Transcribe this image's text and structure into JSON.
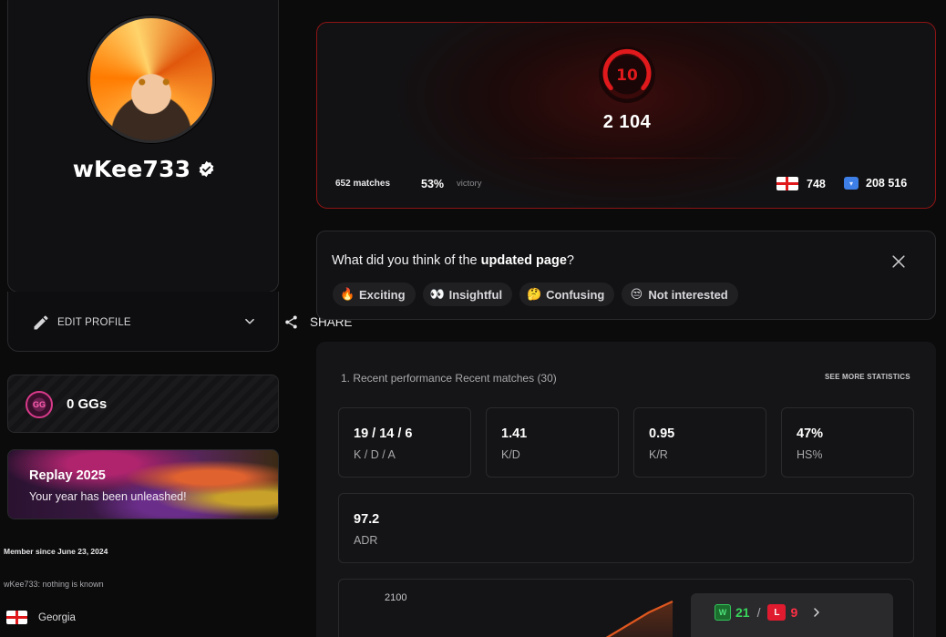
{
  "profile": {
    "username": "wKee733",
    "edit_label": "EDIT PROFILE",
    "share_label": "SHARE"
  },
  "gg": {
    "label": "0 GGs",
    "badge_text": "GG"
  },
  "replay": {
    "title": "Replay 2025",
    "subtitle": "Your year has been unleashed!"
  },
  "member_since": "Member since June 23, 2024",
  "bio": "wKee733: nothing is known",
  "country": "Georgia",
  "elo": {
    "level": "10",
    "points": "2 104",
    "matches": "652 matches",
    "win_pct": "53%",
    "win_label": "victory",
    "country_rank": "748",
    "world_rank": "208 516",
    "accent": "#e0191c"
  },
  "feedback": {
    "question_prefix": "What did you think of the ",
    "question_bold": "updated page",
    "question_suffix": "?",
    "chips": [
      {
        "emoji": "🔥",
        "label": "Exciting"
      },
      {
        "emoji": "👀",
        "label": "Insightful"
      },
      {
        "emoji": "🤔",
        "label": "Confusing"
      },
      {
        "emoji": "😒",
        "label": "Not interested"
      }
    ]
  },
  "stats": {
    "heading": "1. Recent performance Recent matches (30)",
    "see_more": "SEE MORE STATISTICS",
    "boxes": [
      {
        "value": "19 / 14 / 6",
        "label": "K / D / A"
      },
      {
        "value": "1.41",
        "label": "K/D"
      },
      {
        "value": "0.95",
        "label": "K/R"
      },
      {
        "value": "47%",
        "label": "HS%"
      }
    ],
    "adr": {
      "value": "97.2",
      "label": "ADR"
    }
  },
  "chart": {
    "tick_label": "2100",
    "line_color": "#e0571f",
    "wins": "21",
    "losses": "9",
    "win_badge": "W",
    "loss_badge": "L"
  }
}
